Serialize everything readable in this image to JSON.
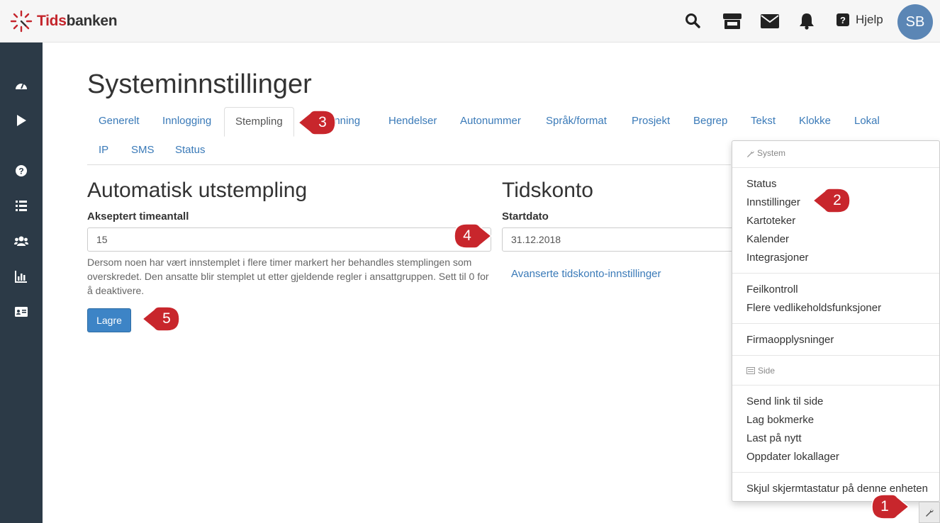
{
  "app": {
    "logo_part1": "Tids",
    "logo_part2": "banken"
  },
  "header": {
    "help_label": "Hjelp",
    "avatar_initials": "SB"
  },
  "page": {
    "title": "Systeminnstillinger"
  },
  "tabs": [
    {
      "label": "Generelt"
    },
    {
      "label": "Innlogging"
    },
    {
      "label": "Stempling"
    },
    {
      "label": "enning"
    },
    {
      "label": "Hendelser"
    },
    {
      "label": "Autonummer"
    },
    {
      "label": "Språk/format"
    },
    {
      "label": "Prosjekt"
    },
    {
      "label": "Begrep"
    },
    {
      "label": "Tekst"
    },
    {
      "label": "Klokke"
    },
    {
      "label": "Lokal"
    },
    {
      "label": "IP"
    },
    {
      "label": "SMS"
    },
    {
      "label": "Status"
    }
  ],
  "active_tab": "Stempling",
  "auto_section": {
    "heading": "Automatisk utstempling",
    "field_label": "Akseptert timeantall",
    "field_value": "15",
    "help_text": "Dersom noen har vært innstemplet i flere timer markert her behandles stemplingen som overskredet. Den ansatte blir stemplet ut etter gjeldende regler i ansattgruppen. Sett til 0 for å deaktivere.",
    "save_label": "Lagre"
  },
  "account_section": {
    "heading": "Tidskonto",
    "field_label": "Startdato",
    "field_value": "31.12.2018",
    "advanced_link": "Avanserte tidskonto-innstillinger"
  },
  "menu": {
    "system_header": "System",
    "system_items": [
      "Status",
      "Innstillinger",
      "Kartoteker",
      "Kalender",
      "Integrasjoner"
    ],
    "maint_items": [
      "Feilkontroll",
      "Flere vedlikeholdsfunksjoner"
    ],
    "company_items": [
      "Firmaopplysninger"
    ],
    "side_header": "Side",
    "side_items": [
      "Send link til side",
      "Lag bokmerke",
      "Last på nytt",
      "Oppdater lokallager"
    ],
    "keyboard_item": "Skjul skjermtastatur på denne enheten"
  },
  "callouts": [
    "1",
    "2",
    "3",
    "4",
    "5"
  ],
  "colors": {
    "brand_red": "#c4252c",
    "sidebar": "#2c3a47",
    "link_blue": "#3a7ab8",
    "primary_button": "#3d84c6",
    "callout_red": "#c8262c",
    "avatar": "#5b86b5"
  },
  "icons": {
    "header": [
      "search-icon",
      "store-icon",
      "mail-icon",
      "bell-icon",
      "help-icon"
    ],
    "sidebar": [
      "dashboard-icon",
      "play-icon",
      "question-icon",
      "list-icon",
      "users-icon",
      "chart-icon",
      "id-card-icon"
    ],
    "menu": [
      "wrench-icon",
      "page-icon",
      "calendar-icon"
    ]
  }
}
